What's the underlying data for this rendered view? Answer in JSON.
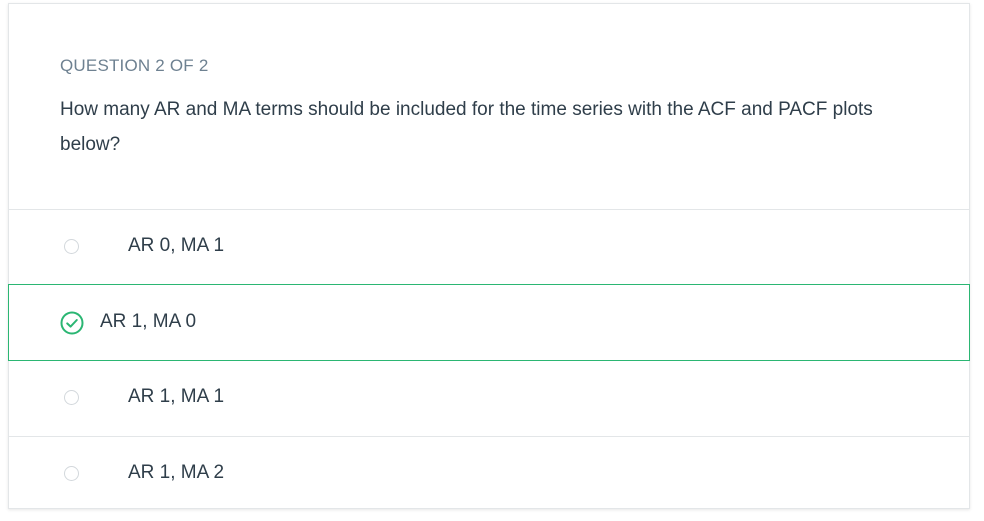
{
  "question": {
    "counter": "QUESTION 2 OF 2",
    "text": "How many AR and MA terms should be included for the time series with the ACF and PACF plots below?"
  },
  "options": [
    {
      "label": "AR 0, MA 1",
      "selected": false
    },
    {
      "label": "AR 1, MA 0",
      "selected": true
    },
    {
      "label": "AR 1, MA 1",
      "selected": false
    },
    {
      "label": "AR 1, MA 2",
      "selected": false
    }
  ],
  "colors": {
    "selected_border": "#2bb673",
    "counter_text": "#6e8191",
    "body_text": "#2f3e4a"
  },
  "icons": {
    "selected": "check-circle-icon",
    "unselected": "radio-circle-icon"
  }
}
